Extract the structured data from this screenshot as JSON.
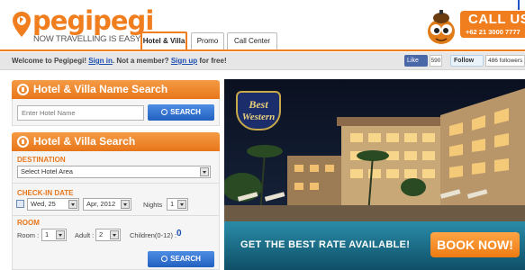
{
  "header": {
    "logo_text": "pegipegi",
    "logo_tagline": "NOW TRAVELLING IS EASY",
    "tabs": [
      {
        "label": "Hotel & Villa",
        "active": true
      },
      {
        "label": "Promo",
        "active": false
      },
      {
        "label": "Call Center",
        "active": false
      }
    ],
    "call_title": "CALL US",
    "call_number": "+62 21 3000 7777",
    "accent_color": "#f07e1e"
  },
  "welcome_bar": {
    "prefix": "Welcome to Pegipegi!",
    "sign_in": "Sign in",
    "middle": ". Not a member?",
    "sign_up": "Sign up",
    "suffix": "for free!",
    "fb_like": "Like",
    "fb_count": "590",
    "tw_follow": "Follow",
    "tw_followers": "486 followers"
  },
  "name_search": {
    "title": "Hotel & Villa Name Search",
    "placeholder": "Enter Hotel Name",
    "button": "SEARCH"
  },
  "villa_search": {
    "title": "Hotel & Villa Search",
    "destination_label": "DESTINATION",
    "destination_value": "Select Hotel Area",
    "checkin_label": "CHECK-IN DATE",
    "checkin_day": "Wed, 25",
    "checkin_month": "Apr, 2012",
    "nights_label": "Nights",
    "nights_value": "1",
    "room_section_label": "ROOM",
    "room_label": "Room :",
    "room_value": "1",
    "adult_label": "Adult :",
    "adult_value": "2",
    "children_label": "Children(0-12) :",
    "children_value": "0",
    "button": "SEARCH"
  },
  "banner": {
    "brand_line1": "Best",
    "brand_line2": "Western",
    "cta_text": "GET THE BEST RATE AVAILABLE!",
    "cta_button": "BOOK NOW!"
  }
}
